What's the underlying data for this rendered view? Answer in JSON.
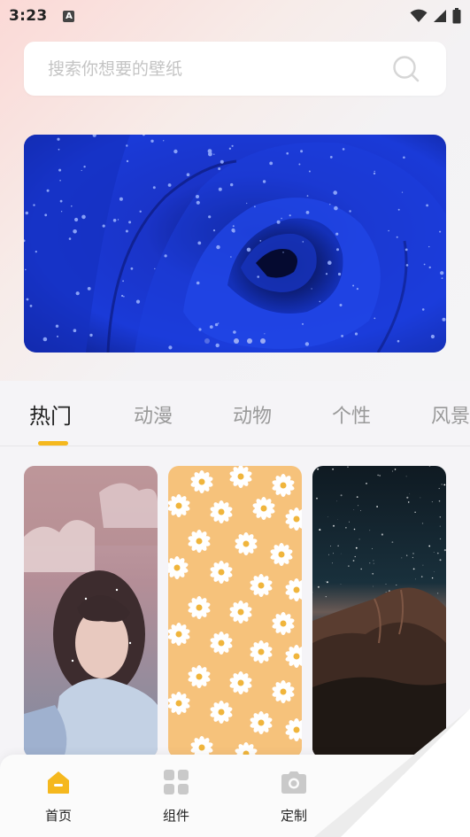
{
  "status_bar": {
    "time": "3:23",
    "notification_icon": "a-icon",
    "wifi_icon": "wifi-icon",
    "signal_icon": "signal-icon",
    "battery_icon": "battery-icon",
    "notification_glyph": "A"
  },
  "search": {
    "placeholder": "搜索你想要的壁纸",
    "value": "",
    "icon": "search-icon"
  },
  "banner": {
    "image": "blue-rose-wallpaper",
    "page_count": 4,
    "active_page": 1
  },
  "categories": {
    "tabs": [
      {
        "label": "热门",
        "active": true
      },
      {
        "label": "动漫",
        "active": false
      },
      {
        "label": "动物",
        "active": false
      },
      {
        "label": "个性",
        "active": false
      },
      {
        "label": "风景",
        "active": false
      }
    ],
    "accent_color": "#f5b81e"
  },
  "wallpapers": [
    {
      "image": "girl-portrait-wallpaper"
    },
    {
      "image": "daisy-pattern-wallpaper"
    },
    {
      "image": "starry-mountain-wallpaper"
    }
  ],
  "bottom_nav": {
    "items": [
      {
        "label": "首页",
        "icon": "home-icon",
        "active": true
      },
      {
        "label": "组件",
        "icon": "widgets-icon",
        "active": false
      },
      {
        "label": "定制",
        "icon": "camera-icon",
        "active": false
      }
    ],
    "active_color": "#f5b81e",
    "inactive_icon_color": "#c9c9c9"
  }
}
